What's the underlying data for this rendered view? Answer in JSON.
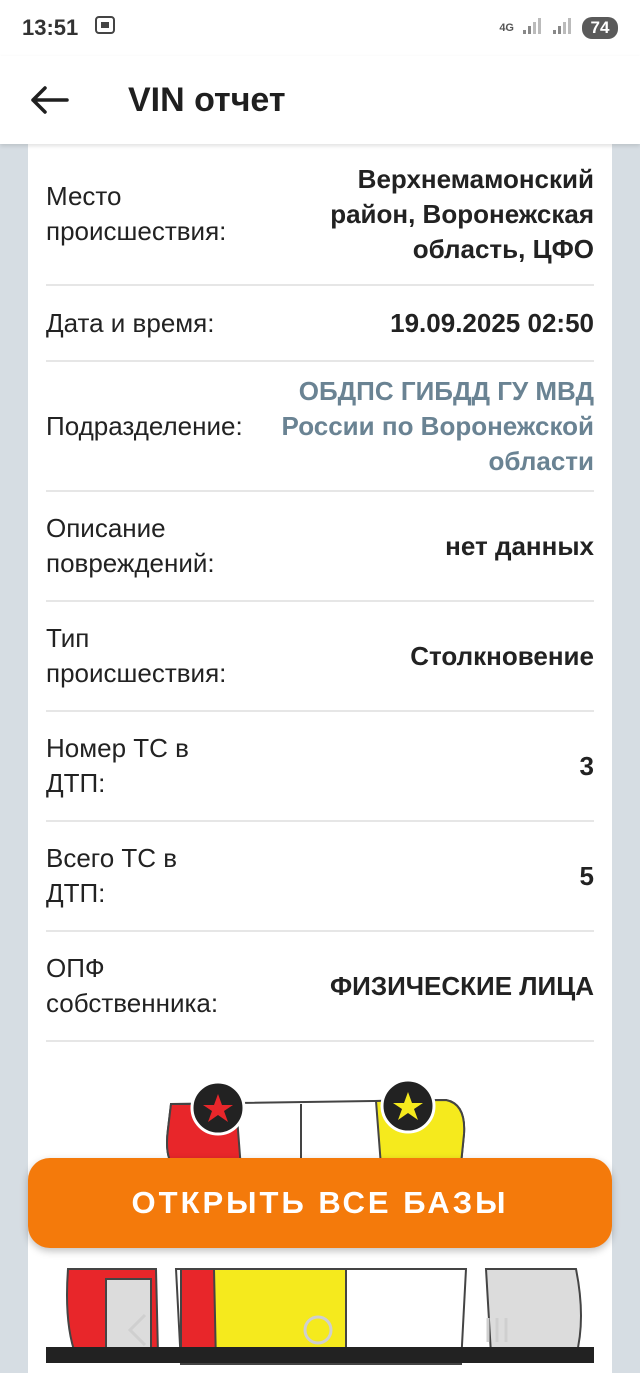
{
  "status": {
    "time": "13:51",
    "network": "4G",
    "battery": "74"
  },
  "header": {
    "title": "VIN отчет"
  },
  "details": [
    {
      "label": "Место происшествия:",
      "value": "Верхнемамонский район, Воронежская область, ЦФО",
      "style": "normal"
    },
    {
      "label": "Дата и время:",
      "value": "19.09.2025 02:50",
      "style": "normal"
    },
    {
      "label": "Подразделение:",
      "value": "ОБДПС ГИБДД ГУ МВД России по Воронежской области",
      "style": "link"
    },
    {
      "label": "Описание повреждений:",
      "value": "нет данных",
      "style": "normal"
    },
    {
      "label": "Тип происшествия:",
      "value": "Столкновение",
      "style": "normal"
    },
    {
      "label": "Номер ТС в ДТП:",
      "value": "3",
      "style": "normal"
    },
    {
      "label": "Всего ТС в ДТП:",
      "value": "5",
      "style": "normal"
    },
    {
      "label": "ОПФ собственника:",
      "value": "ФИЗИЧЕСКИЕ ЛИЦА",
      "style": "normal"
    }
  ],
  "cta": {
    "label": "ОТКРЫТЬ ВСЕ БАЗЫ"
  },
  "colors": {
    "accent": "#f47a0b",
    "link": "#6a8393",
    "background": "#d6dde3",
    "damage_red": "#e8262a",
    "damage_yellow": "#f5ea1d"
  }
}
